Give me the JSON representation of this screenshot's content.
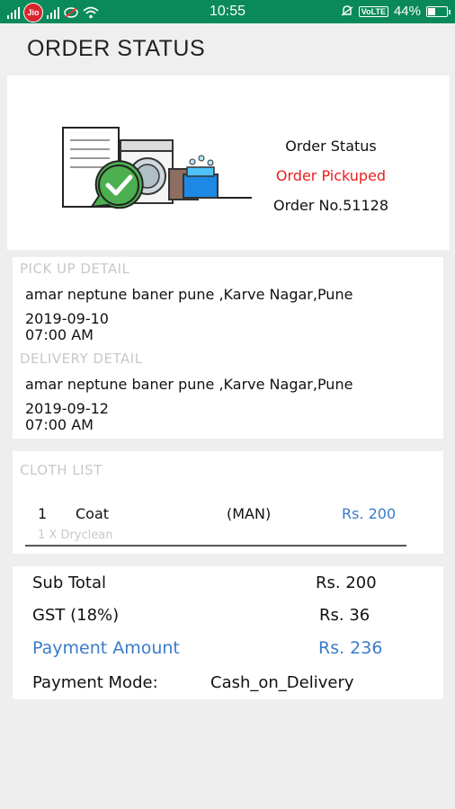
{
  "status_bar": {
    "carrier": "Jio",
    "time": "10:55",
    "volte": "VoLTE",
    "battery": "44%",
    "battery_level": 0.44
  },
  "app_bar": {
    "title": "ORDER STATUS"
  },
  "order": {
    "status_heading": "Order Status",
    "status_value": "Order Pickuped",
    "order_number": "Order No.51128"
  },
  "pickup": {
    "label": "PICK UP DETAIL",
    "address": "amar neptune baner pune ,Karve Nagar,Pune",
    "date": "2019-09-10",
    "time": "07:00 AM"
  },
  "delivery": {
    "label": "DELIVERY DETAIL",
    "address": "amar neptune baner pune ,Karve Nagar,Pune",
    "date": "2019-09-12",
    "time": "07:00 AM"
  },
  "cloth_list": {
    "label": "CLOTH LIST",
    "items": [
      {
        "qty": "1",
        "name": "Coat",
        "category": "(MAN)",
        "price": "Rs. 200",
        "service": "1 X Dryclean"
      }
    ]
  },
  "totals": {
    "sub_total_label": "Sub Total",
    "sub_total_value": "Rs. 200",
    "gst_label": "GST (18%)",
    "gst_value": "Rs. 36",
    "payment_label": "Payment Amount",
    "payment_value": "Rs. 236",
    "mode_label": "Payment Mode:",
    "mode_value": "Cash_on_Delivery"
  },
  "colors": {
    "status_bar": "#0a8a5a",
    "accent_red": "#e81e1e",
    "accent_blue": "#3a7cc8",
    "muted": "#c8c8c8"
  }
}
